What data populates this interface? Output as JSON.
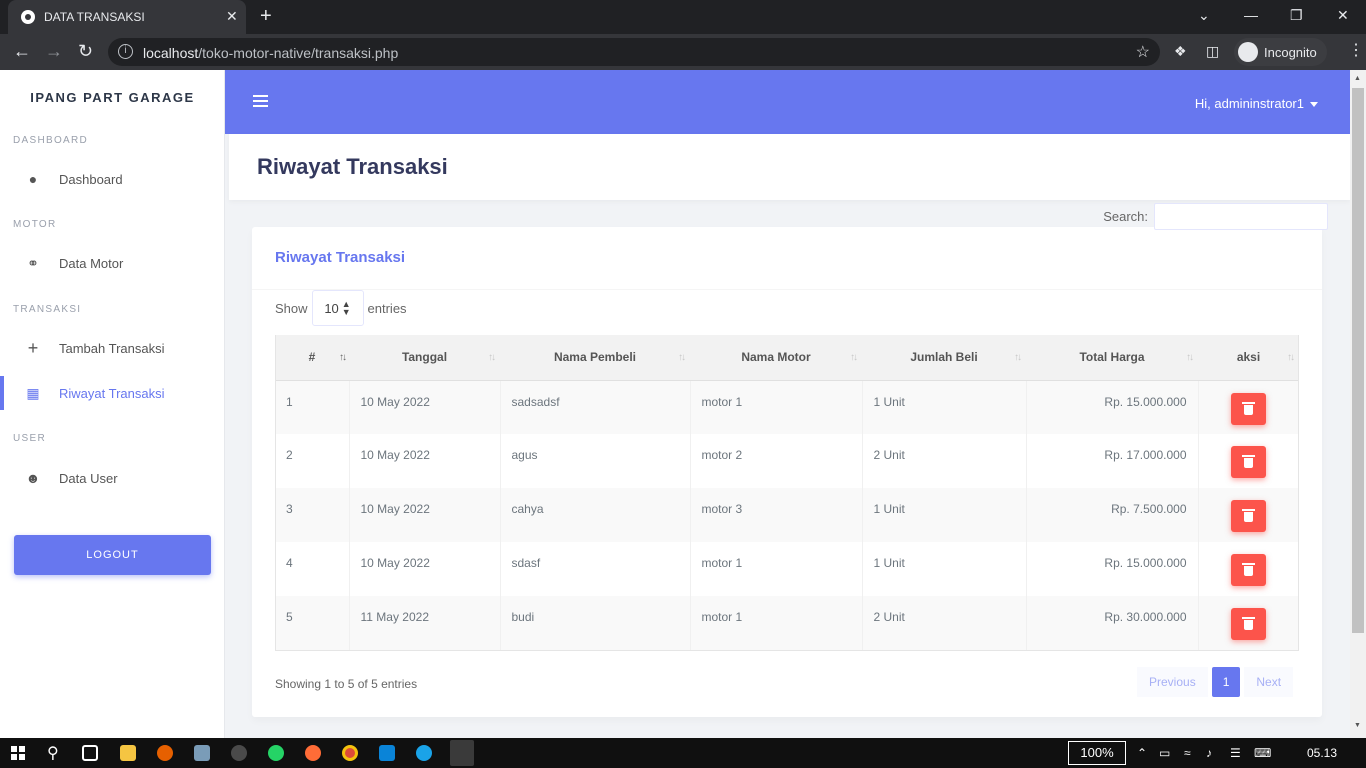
{
  "browser": {
    "tab_title": "DATA TRANSAKSI",
    "tab_close": "✕",
    "new_tab": "+",
    "url_host": "localhost",
    "url_path": "/toko-motor-native/transaksi.php",
    "incognito_label": "Incognito"
  },
  "sidebar": {
    "brand": "IPANG PART GARAGE",
    "sections": {
      "dashboard": "DASHBOARD",
      "motor": "MOTOR",
      "transaksi": "TRANSAKSI",
      "user": "USER"
    },
    "items": [
      {
        "label": "Dashboard",
        "icon": "fire-icon"
      },
      {
        "label": "Data Motor",
        "icon": "motorcycle-icon"
      },
      {
        "label": "Tambah Transaksi",
        "icon": "plus-icon"
      },
      {
        "label": "Riwayat Transaksi",
        "icon": "grid-icon",
        "active": true
      },
      {
        "label": "Data User",
        "icon": "users-icon"
      }
    ],
    "logout": "LOGOUT"
  },
  "topnav": {
    "user_greeting": "Hi, admininstrator1"
  },
  "page": {
    "title": "Riwayat Transaksi"
  },
  "card": {
    "title": "Riwayat Transaksi",
    "show_label": "Show",
    "page_length": "10",
    "entries_label": "entries",
    "search_label": "Search:",
    "search_value": ""
  },
  "table": {
    "columns": [
      "#",
      "Tanggal",
      "Nama Pembeli",
      "Nama Motor",
      "Jumlah Beli",
      "Total Harga",
      "aksi"
    ],
    "rows": [
      {
        "no": "1",
        "tanggal": "10 May 2022",
        "pembeli": "sadsadsf",
        "motor": "motor 1",
        "jumlah": "1 Unit",
        "total": "Rp. 15.000.000"
      },
      {
        "no": "2",
        "tanggal": "10 May 2022",
        "pembeli": "agus",
        "motor": "motor 2",
        "jumlah": "2 Unit",
        "total": "Rp. 17.000.000"
      },
      {
        "no": "3",
        "tanggal": "10 May 2022",
        "pembeli": "cahya",
        "motor": "motor 3",
        "jumlah": "1 Unit",
        "total": "Rp. 7.500.000"
      },
      {
        "no": "4",
        "tanggal": "10 May 2022",
        "pembeli": "sdasf",
        "motor": "motor 1",
        "jumlah": "1 Unit",
        "total": "Rp. 15.000.000"
      },
      {
        "no": "5",
        "tanggal": "11 May 2022",
        "pembeli": "budi",
        "motor": "motor 1",
        "jumlah": "2 Unit",
        "total": "Rp. 30.000.000"
      }
    ]
  },
  "footer": {
    "info": "Showing 1 to 5 of 5 entries",
    "previous": "Previous",
    "current_page": "1",
    "next": "Next"
  },
  "taskbar": {
    "zoom": "100%",
    "time": "05.13"
  },
  "colors": {
    "primary": "#6777ef",
    "danger": "#fc544b"
  }
}
